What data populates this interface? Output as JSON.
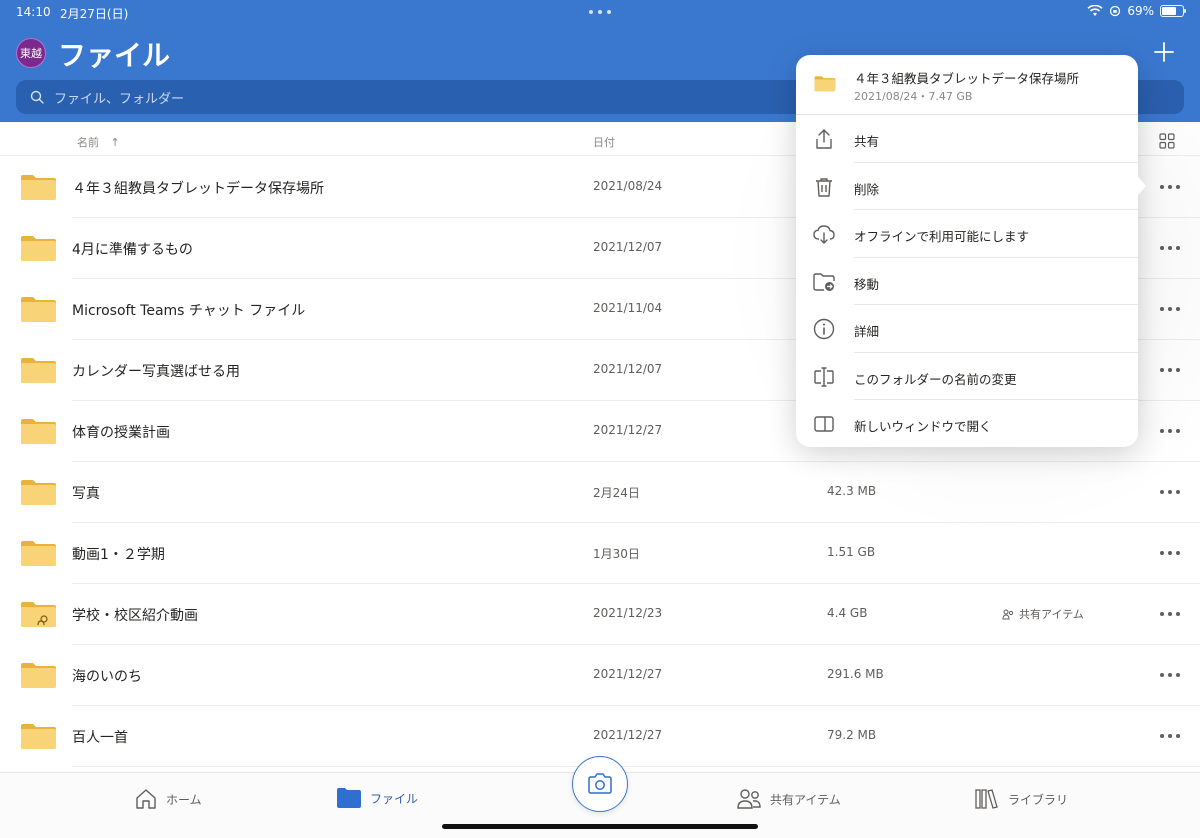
{
  "status_bar": {
    "time": "14:10",
    "date": "2月27日(日)",
    "battery": "69%",
    "battery_level": 0.69
  },
  "header": {
    "avatar_text": "東越",
    "title": "ファイル"
  },
  "search": {
    "placeholder": "ファイル、フォルダー"
  },
  "columns": {
    "name": "名前",
    "date": "日付"
  },
  "files": [
    {
      "name": "４年３組教員タブレットデータ保存場所",
      "date": "2021/08/24",
      "size": "",
      "shared": ""
    },
    {
      "name": "4月に準備するもの",
      "date": "2021/12/07",
      "size": "",
      "shared": ""
    },
    {
      "name": "Microsoft Teams チャット ファイル",
      "date": "2021/11/04",
      "size": "",
      "shared": ""
    },
    {
      "name": "カレンダー写真選ばせる用",
      "date": "2021/12/07",
      "size": "",
      "shared": ""
    },
    {
      "name": "体育の授業計画",
      "date": "2021/12/27",
      "size": "",
      "shared": ""
    },
    {
      "name": "写真",
      "date": "2月24日",
      "size": "42.3 MB",
      "shared": ""
    },
    {
      "name": "動画1・２学期",
      "date": "1月30日",
      "size": "1.51 GB",
      "shared": ""
    },
    {
      "name": "学校・校区紹介動画",
      "date": "2021/12/23",
      "size": "4.4 GB",
      "shared": "共有アイテム"
    },
    {
      "name": "海のいのち",
      "date": "2021/12/27",
      "size": "291.6 MB",
      "shared": ""
    },
    {
      "name": "百人一首",
      "date": "2021/12/27",
      "size": "79.2 MB",
      "shared": ""
    }
  ],
  "context_menu": {
    "title": "４年３組教員タブレットデータ保存場所",
    "subtitle": "2021/08/24・7.47 GB",
    "items": [
      {
        "label": "共有",
        "icon": "share-icon"
      },
      {
        "label": "削除",
        "icon": "trash-icon"
      },
      {
        "label": "オフラインで利用可能にします",
        "icon": "cloud-download-icon"
      },
      {
        "label": "移動",
        "icon": "move-folder-icon"
      },
      {
        "label": "詳細",
        "icon": "info-icon"
      },
      {
        "label": "このフォルダーの名前の変更",
        "icon": "rename-icon"
      },
      {
        "label": "新しいウィンドウで開く",
        "icon": "new-window-icon"
      }
    ]
  },
  "tab_bar": {
    "home": "ホーム",
    "files": "ファイル",
    "shared": "共有アイテム",
    "library": "ライブラリ"
  },
  "colors": {
    "header_blue": "#3a78d0",
    "folder_yellow": "#f5c95f",
    "active_tab": "#2f5fab"
  }
}
